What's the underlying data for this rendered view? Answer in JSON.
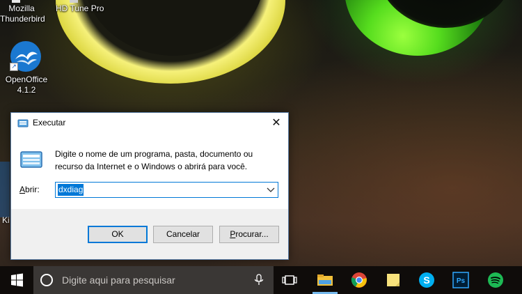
{
  "desktop": {
    "icons": [
      {
        "label": "Mozilla\nThunderbird"
      },
      {
        "label": "HD Tune Pro"
      },
      {
        "label": "OpenOffice\n4.1.2"
      },
      {
        "label": "Ki"
      }
    ]
  },
  "run_dialog": {
    "title": "Executar",
    "close_glyph": "✕",
    "description": "Digite o nome de um programa, pasta, documento ou recurso da Internet e o Windows o abrirá para você.",
    "open_label_accel": "A",
    "open_label_rest": "brir:",
    "input_value": "dxdiag",
    "ok_label": "OK",
    "cancel_label": "Cancelar",
    "browse_label_accel": "P",
    "browse_label_rest": "rocurar..."
  },
  "taskbar": {
    "search_placeholder": "Digite aqui para pesquisar",
    "pinned_icons": [
      "task-view-icon",
      "file-explorer-icon",
      "chrome-icon",
      "sticky-notes-icon",
      "skype-icon",
      "photoshop-icon",
      "spotify-icon"
    ]
  },
  "colors": {
    "accent": "#0078d7",
    "taskbar_bg": "#0f0c0a",
    "search_bg": "#3a3735"
  }
}
